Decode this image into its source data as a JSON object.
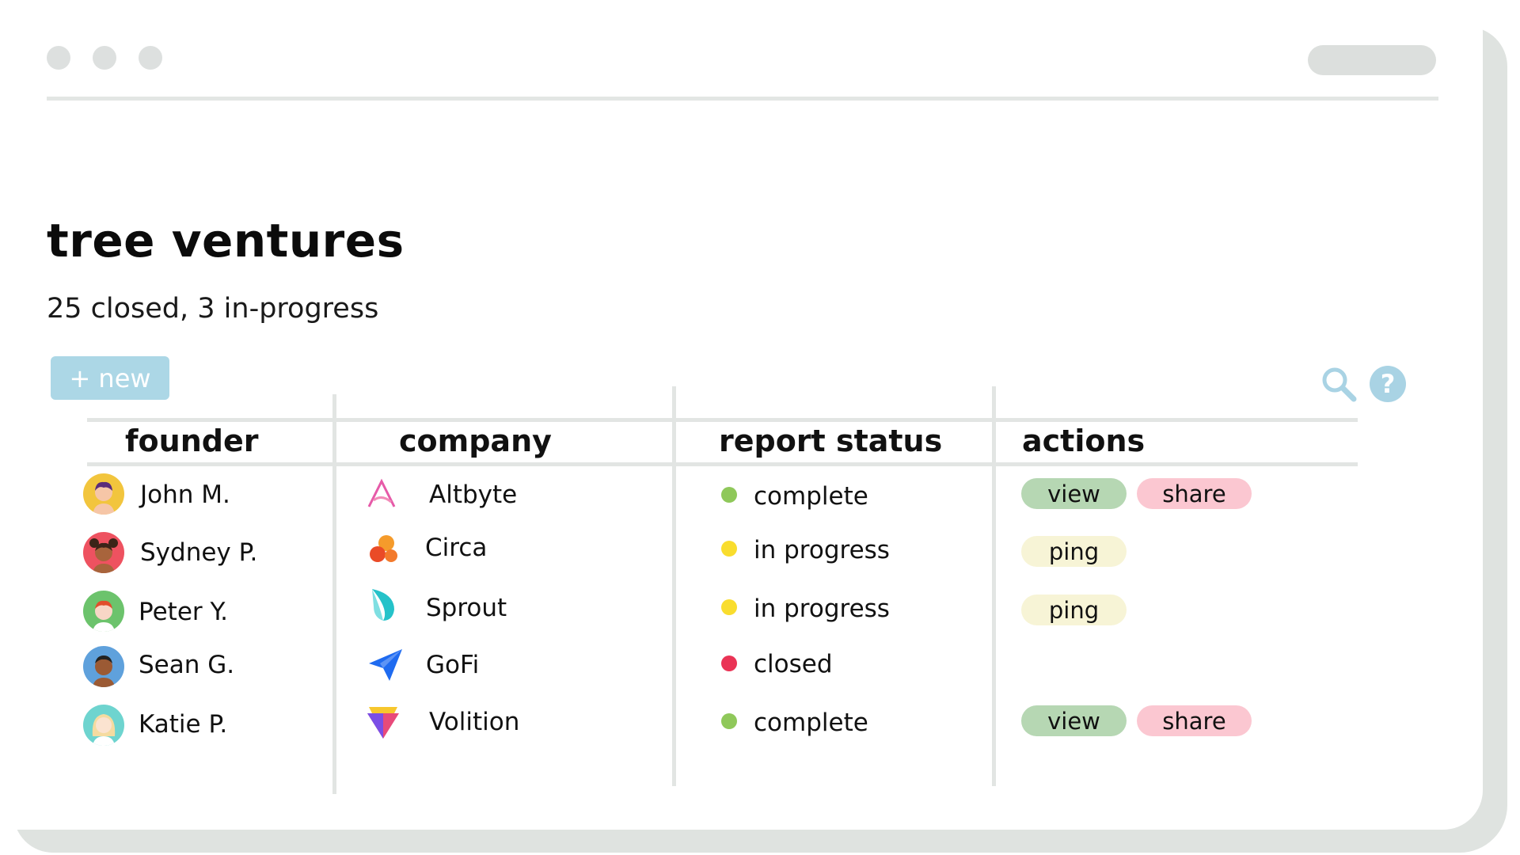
{
  "page": {
    "title": "tree ventures",
    "subtitle": "25 closed, 3 in-progress",
    "new_button": "+ new"
  },
  "toolbar": {
    "icons": [
      "search-icon",
      "help-icon"
    ],
    "help_glyph": "?"
  },
  "table": {
    "headers": [
      "founder",
      "company",
      "report status",
      "actions"
    ],
    "rows": [
      {
        "founder": "John M.",
        "company": "Altbyte",
        "status": "complete",
        "status_color": "#8fc85a",
        "actions": [
          "view",
          "share"
        ]
      },
      {
        "founder": "Sydney P.",
        "company": "Circa",
        "status": "in progress",
        "status_color": "#f9dd2e",
        "actions": [
          "ping"
        ]
      },
      {
        "founder": "Peter Y.",
        "company": "Sprout",
        "status": "in progress",
        "status_color": "#f9dd2e",
        "actions": [
          "ping"
        ]
      },
      {
        "founder": "Sean G.",
        "company": "GoFi",
        "status": "closed",
        "status_color": "#ea3355",
        "actions": []
      },
      {
        "founder": "Katie P.",
        "company": "Volition",
        "status": "complete",
        "status_color": "#8fc85a",
        "actions": [
          "view",
          "share"
        ]
      }
    ]
  },
  "colors": {
    "accent": "#acd7e6",
    "view": "#b6d7b3",
    "share": "#fbc7d1",
    "ping": "#f7f4d6"
  }
}
